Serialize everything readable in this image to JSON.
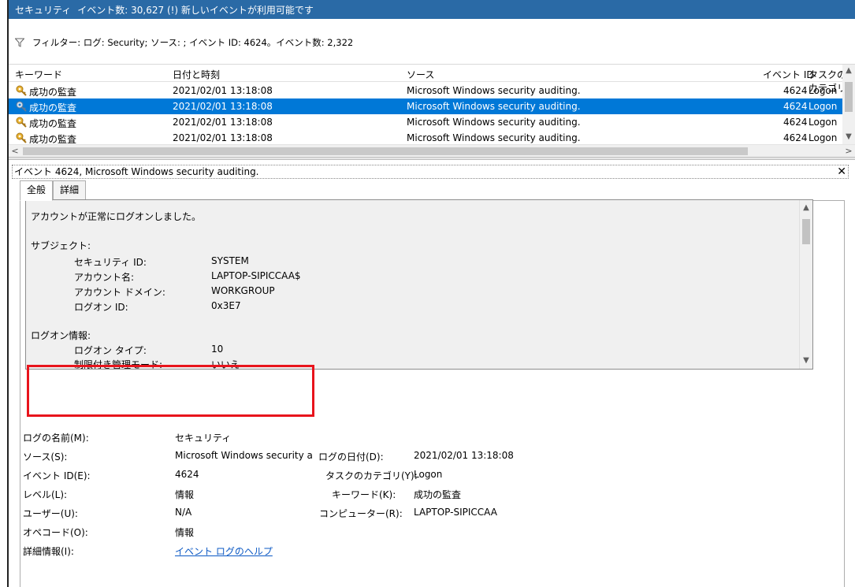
{
  "titlebar": {
    "log_name": "セキュリティ",
    "status": "イベント数: 30,627 (!) 新しいイベントが利用可能です"
  },
  "filter": {
    "text": "フィルター: ログ: Security; ソース: ; イベント ID: 4624。イベント数: 2,322"
  },
  "grid": {
    "columns": [
      "キーワード",
      "日付と時刻",
      "ソース",
      "イベント ID",
      "タスクのカテゴリ"
    ],
    "rows": [
      {
        "keyword": "成功の監査",
        "datetime": "2021/02/01 13:18:08",
        "source": "Microsoft Windows security auditing.",
        "event_id": "4624",
        "task": "Logon"
      },
      {
        "keyword": "成功の監査",
        "datetime": "2021/02/01 13:18:08",
        "source": "Microsoft Windows security auditing.",
        "event_id": "4624",
        "task": "Logon",
        "selected": true
      },
      {
        "keyword": "成功の監査",
        "datetime": "2021/02/01 13:18:08",
        "source": "Microsoft Windows security auditing.",
        "event_id": "4624",
        "task": "Logon"
      },
      {
        "keyword": "成功の監査",
        "datetime": "2021/02/01 13:18:08",
        "source": "Microsoft Windows security auditing.",
        "event_id": "4624",
        "task": "Logon"
      }
    ]
  },
  "detail": {
    "title": "イベント 4624, Microsoft Windows security auditing.",
    "tabs": [
      "全般",
      "詳細"
    ],
    "description": {
      "intro": "アカウントが正常にログオンしました。",
      "subject_header": "サブジェクト:",
      "subject": [
        {
          "label": "セキュリティ ID:",
          "value": "SYSTEM"
        },
        {
          "label": "アカウント名:",
          "value": "LAPTOP-SIPICCAA$"
        },
        {
          "label": "アカウント ドメイン:",
          "value": "WORKGROUP"
        },
        {
          "label": "ログオン ID:",
          "value": "0x3E7"
        }
      ],
      "logon_header": "ログオン情報:",
      "logon": [
        {
          "label": "ログオン タイプ:",
          "value": "10"
        },
        {
          "label": "制限付き管理モード:",
          "value": "いいえ"
        }
      ]
    },
    "props": {
      "log_name_label": "ログの名前(M):",
      "log_name": "セキュリティ",
      "source_label": "ソース(S):",
      "source": "Microsoft Windows security a",
      "logged_label": "ログの日付(D):",
      "logged": "2021/02/01 13:18:08",
      "event_id_label": "イベント ID(E):",
      "event_id": "4624",
      "task_label": "タスクのカテゴリ(Y):",
      "task": "Logon",
      "level_label": "レベル(L):",
      "level": "情報",
      "keywords_label": "キーワード(K):",
      "keywords": "成功の監査",
      "user_label": "ユーザー(U):",
      "user": "N/A",
      "computer_label": "コンピューター(R):",
      "computer": "LAPTOP-SIPICCAA",
      "opcode_label": "オペコード(O):",
      "opcode": "情報",
      "more_info_label": "詳細情報(I):",
      "more_info_link": "イベント ログのヘルプ"
    }
  },
  "colors": {
    "titlebar": "#2a6aa6",
    "selection": "#0078d7",
    "highlight_box": "#e8141c",
    "link": "#0b58c4"
  }
}
